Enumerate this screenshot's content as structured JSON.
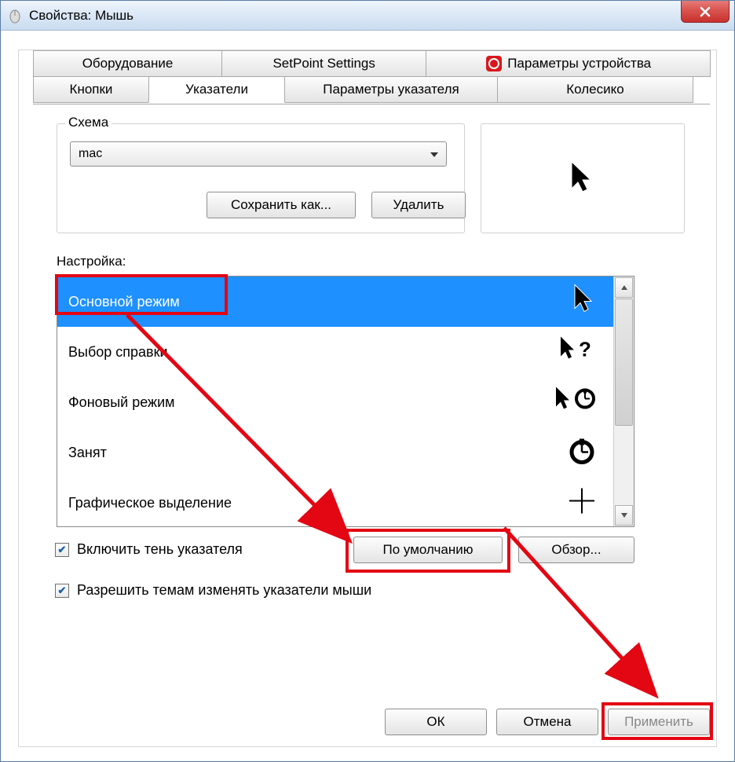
{
  "window": {
    "title": "Свойства: Мышь",
    "close_label": "X"
  },
  "tabs_row1": [
    {
      "label": "Оборудование"
    },
    {
      "label": "SetPoint Settings"
    },
    {
      "label": "Параметры устройства"
    }
  ],
  "tabs_row2": [
    {
      "label": "Кнопки"
    },
    {
      "label": "Указатели"
    },
    {
      "label": "Параметры указателя"
    },
    {
      "label": "Колесико"
    }
  ],
  "scheme": {
    "legend": "Схема",
    "selected": "mac",
    "save_as": "Сохранить как...",
    "delete": "Удалить"
  },
  "settings_label": "Настройка:",
  "cursor_list": [
    {
      "label": "Основной режим",
      "selected": true
    },
    {
      "label": "Выбор справки"
    },
    {
      "label": "Фоновый режим"
    },
    {
      "label": "Занят"
    },
    {
      "label": "Графическое выделение"
    }
  ],
  "checkbox_shadow": "Включить тень указателя",
  "checkbox_themes": "Разрешить темам изменять указатели мыши",
  "buttons": {
    "default": "По умолчанию",
    "browse": "Обзор...",
    "ok": "ОК",
    "cancel": "Отмена",
    "apply": "Применить"
  }
}
